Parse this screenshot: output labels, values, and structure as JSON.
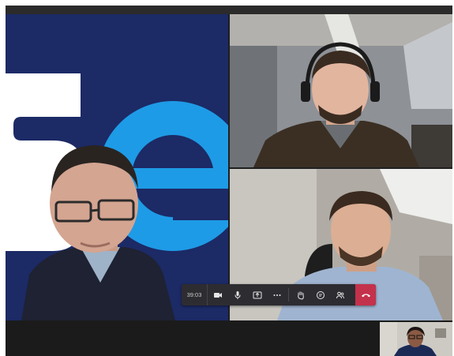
{
  "call": {
    "duration": "39:03"
  },
  "controls": {
    "items": [
      {
        "name": "video-icon"
      },
      {
        "name": "microphone-icon"
      },
      {
        "name": "share-screen-icon"
      },
      {
        "name": "more-options-icon"
      },
      {
        "name": "raise-hand-icon"
      },
      {
        "name": "chat-icon"
      },
      {
        "name": "participants-icon"
      },
      {
        "name": "hang-up-icon"
      }
    ]
  },
  "colors": {
    "hang_up": "#c4314b",
    "toolbar_bg": "#2d2c31",
    "logo_blue": "#1c2a66",
    "logo_cyan": "#1e9be6"
  }
}
